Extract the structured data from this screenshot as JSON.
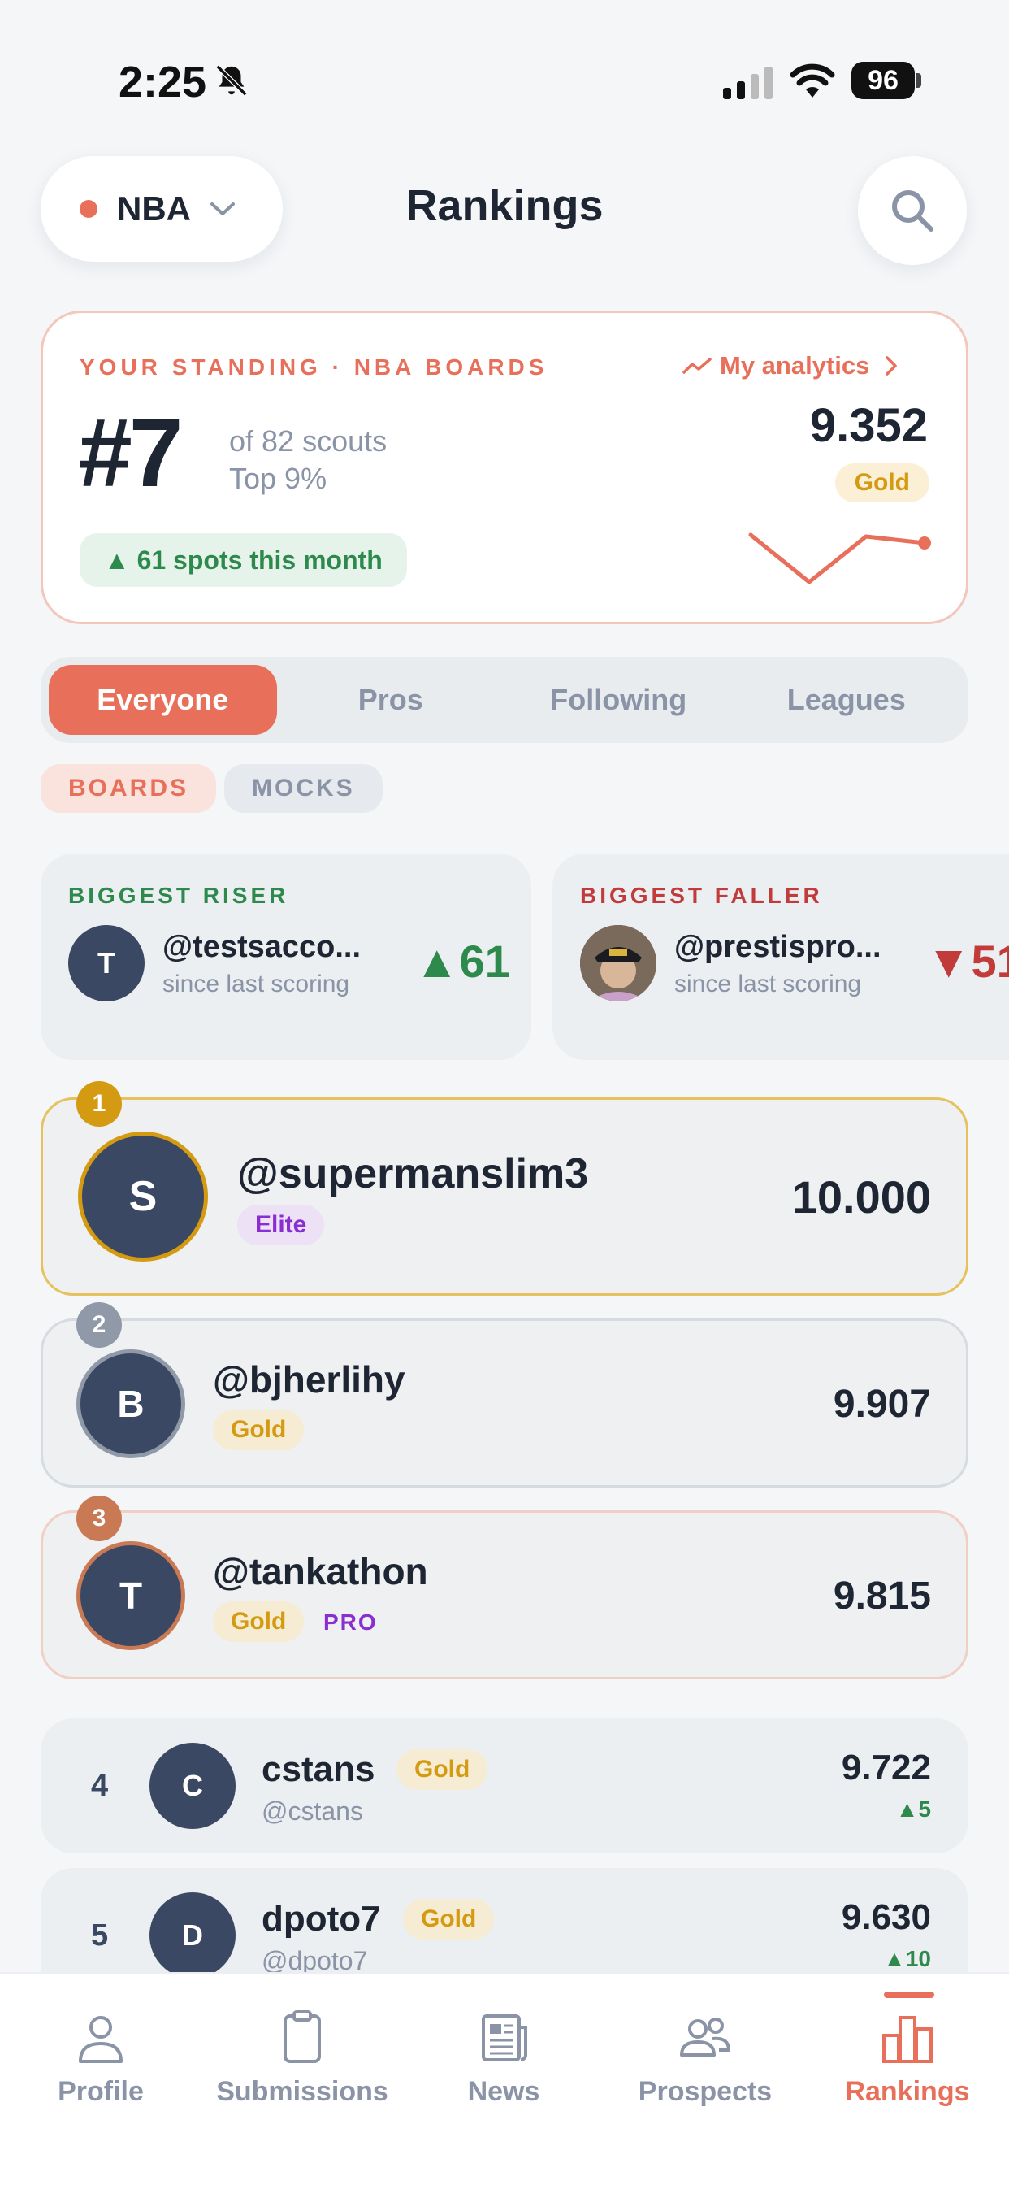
{
  "status_bar": {
    "time": "2:25",
    "battery": "96"
  },
  "header": {
    "league": "NBA",
    "title": "Rankings"
  },
  "standing": {
    "kicker": "YOUR STANDING · NBA BOARDS",
    "analytics_label": "My analytics",
    "rank": "#7",
    "of_scouts": "of 82 scouts",
    "top_pct": "Top 9%",
    "score": "9.352",
    "tier": "Gold",
    "spots": "61 spots this month"
  },
  "segments": [
    "Everyone",
    "Pros",
    "Following",
    "Leagues"
  ],
  "chips": {
    "boards": "BOARDS",
    "mocks": "MOCKS"
  },
  "movers": {
    "riser": {
      "kicker": "BIGGEST RISER",
      "initial": "T",
      "name": "@testsacco...",
      "sub": "since last scoring",
      "delta": "61"
    },
    "faller": {
      "kicker": "BIGGEST FALLER",
      "name": "@prestispro...",
      "sub": "since last scoring",
      "delta": "51"
    }
  },
  "podium": [
    {
      "rank": "1",
      "initial": "S",
      "name": "@supermanslim3",
      "tag": "Elite",
      "score": "10.000"
    },
    {
      "rank": "2",
      "initial": "B",
      "name": "@bjherlihy",
      "tag": "Gold",
      "score": "9.907"
    },
    {
      "rank": "3",
      "initial": "T",
      "name": "@tankathon",
      "tag": "Gold",
      "pro": "PRO",
      "score": "9.815"
    }
  ],
  "list": [
    {
      "rank": "4",
      "initial": "C",
      "name": "cstans",
      "tag": "Gold",
      "handle": "@cstans",
      "score": "9.722",
      "delta": "5"
    },
    {
      "rank": "5",
      "initial": "D",
      "name": "dpoto7",
      "tag": "Gold",
      "handle": "@dpoto7",
      "score": "9.630",
      "delta": "10"
    }
  ],
  "tabs": {
    "profile": "Profile",
    "submissions": "Submissions",
    "news": "News",
    "prospects": "Prospects",
    "rankings": "Rankings"
  },
  "colors": {
    "accent": "#e8705a",
    "gold": "#d49a12",
    "green": "#2e8a4c",
    "red": "#c23b3b",
    "purple": "#8a2dd1"
  },
  "icons": {
    "status": [
      "bell-slash-icon",
      "signal-icon",
      "wifi-icon",
      "battery-icon"
    ],
    "header": [
      "chevron-down-icon",
      "search-icon",
      "trend-icon",
      "chevron-right-icon"
    ],
    "tabs": [
      "profile-icon",
      "clipboard-icon",
      "newspaper-icon",
      "people-icon",
      "bar-chart-icon"
    ]
  }
}
